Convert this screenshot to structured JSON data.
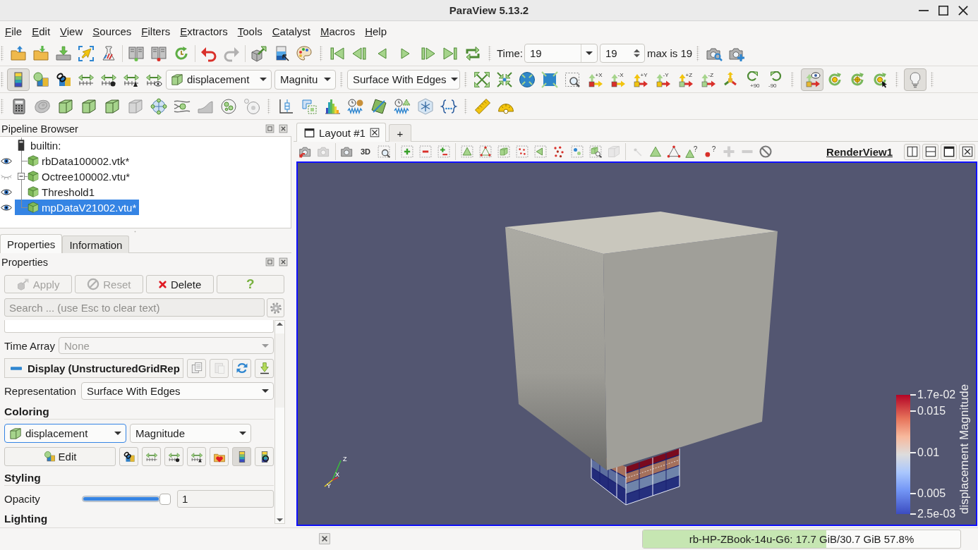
{
  "window": {
    "title": "ParaView 5.13.2"
  },
  "menu": [
    {
      "label": "File"
    },
    {
      "label": "Edit"
    },
    {
      "label": "View"
    },
    {
      "label": "Sources"
    },
    {
      "label": "Filters"
    },
    {
      "label": "Extractors"
    },
    {
      "label": "Tools"
    },
    {
      "label": "Catalyst"
    },
    {
      "label": "Macros"
    },
    {
      "label": "Help"
    }
  ],
  "main_toolbar": {
    "undo": {
      "disabled": false
    },
    "redo": {
      "disabled": true
    }
  },
  "time_toolbar": {
    "label": "Time:",
    "value": "19",
    "index": "19",
    "max_text": "max is 19"
  },
  "color_toolbar": {
    "legend_toggle": {
      "on": true
    },
    "array": "displacement",
    "component": "Magnitu",
    "representation": "Surface With Edges"
  },
  "camera_toolbar": {
    "view_directions": [
      "+X",
      "-X",
      "+Y",
      "-Y",
      "+Z",
      "-Z"
    ],
    "rotations": [
      "+90",
      "-90"
    ],
    "orientation_axes": {
      "on": true
    },
    "light": {
      "on": true
    }
  },
  "pipeline_browser": {
    "title": "Pipeline Browser",
    "root": {
      "label": "builtin:",
      "selected": false,
      "children": [
        {
          "label": "rbData100002.vtk*",
          "visible": true,
          "selected": false
        },
        {
          "label": "Octree100002.vtu*",
          "visible": false,
          "selected": false,
          "expanded": true,
          "children": [
            {
              "label": "Threshold1",
              "visible": true,
              "selected": false
            }
          ]
        },
        {
          "label": "mpDataV21002.vtu*",
          "visible": true,
          "selected": true
        }
      ]
    }
  },
  "panel_tabs": [
    {
      "label": "Properties",
      "selected": true
    },
    {
      "label": "Information",
      "selected": false
    }
  ],
  "properties": {
    "title": "Properties",
    "buttons": [
      {
        "kind": "apply",
        "label": "Apply",
        "disabled": true
      },
      {
        "kind": "reset",
        "label": "Reset",
        "disabled": true
      },
      {
        "kind": "delete",
        "label": "Delete",
        "disabled": false
      },
      {
        "kind": "help",
        "label": "?",
        "disabled": false
      }
    ],
    "search": {
      "placeholder": "Search ... (use Esc to clear text)"
    },
    "time_array": {
      "label": "Time Array",
      "value": "None",
      "disabled": true
    },
    "display": {
      "title": "Display (UnstructuredGridRep",
      "expanded": true
    },
    "representation": {
      "label": "Representation",
      "value": "Surface With Edges"
    },
    "coloring": {
      "title": "Coloring",
      "array": "displacement",
      "component": "Magnitude",
      "edit": "Edit",
      "legend_on": true
    },
    "styling": {
      "title": "Styling",
      "opacity": {
        "label": "Opacity",
        "level": 1,
        "value": "1"
      }
    },
    "lighting": {
      "title": "Lighting"
    }
  },
  "layout": {
    "tabs": [
      {
        "label": "Layout #1",
        "selected": true
      }
    ],
    "new_tab": "+"
  },
  "view": {
    "projection": "3D",
    "hover_marks": [
      "?",
      "?"
    ],
    "name": "RenderView1",
    "axes": [
      "X",
      "Y",
      "Z"
    ],
    "legend": {
      "title": "displacement Magnitude",
      "ticks": [
        "1.7e-02",
        "0.015",
        "0.01",
        "0.005",
        "2.5e-03"
      ]
    }
  },
  "status_bar": {
    "memory": {
      "text": "rb-HP-ZBook-14u-G6: 17.7 GiB/30.7 GiB 57.8%",
      "level": 0.578
    }
  }
}
